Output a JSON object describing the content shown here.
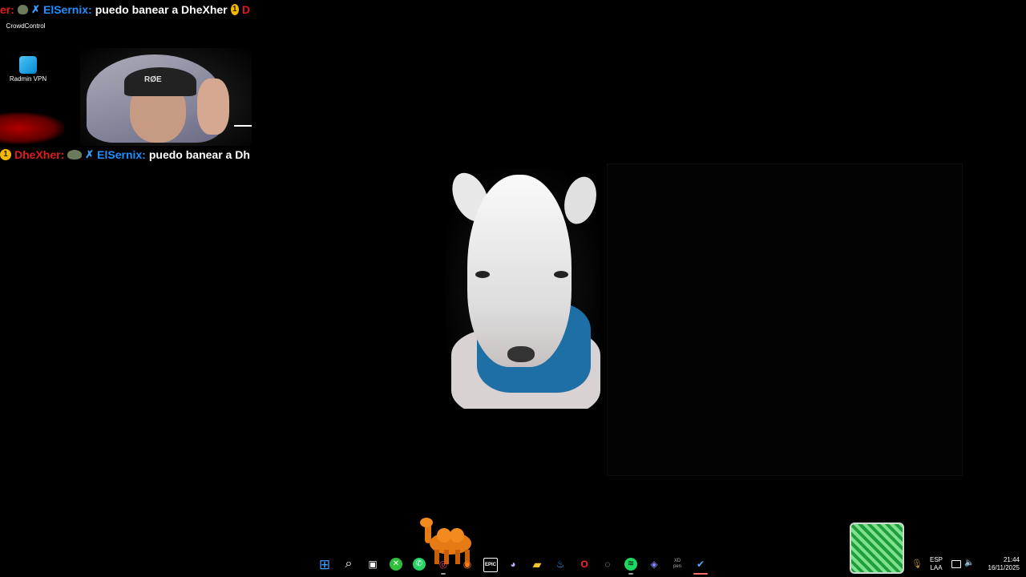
{
  "stream_overlay": {
    "chat_top": {
      "user1_tail": "er:",
      "user2": "ElSernix:",
      "message": "puedo banear a DheXher",
      "badge_count": "1",
      "trailing": "D"
    },
    "chat_bottom": {
      "badge_count": "1",
      "user1": "DheXher:",
      "user2": "ElSernix:",
      "message": "puedo banear a Dh"
    },
    "webcam": {
      "cap_text": "RØE"
    }
  },
  "desktop": {
    "icons": [
      {
        "label": "CrowdControl",
        "icon": "crowdcontrol-icon"
      },
      {
        "label": "Radmin VPN",
        "icon": "radmin-vpn-icon"
      }
    ]
  },
  "taskbar": {
    "apps": [
      {
        "name": "windows-start",
        "glyph": "⊞",
        "color": "#3aa0ff"
      },
      {
        "name": "search",
        "glyph": "⌕",
        "color": "#ffffff"
      },
      {
        "name": "task-view",
        "glyph": "▣",
        "color": "#ffffff"
      },
      {
        "name": "xbox",
        "glyph": "✕",
        "color": "#2fbf3a"
      },
      {
        "name": "whatsapp",
        "glyph": "✆",
        "color": "#25d366"
      },
      {
        "name": "opera-gx",
        "glyph": "◎",
        "color": "#e0336a"
      },
      {
        "name": "firefox",
        "glyph": "◉",
        "color": "#ff7a1a"
      },
      {
        "name": "epic-games",
        "glyph": "EPIC",
        "color": "#ffffff"
      },
      {
        "name": "obs",
        "glyph": "◕",
        "color": "#c9a7ff"
      },
      {
        "name": "file-explorer",
        "glyph": "▰",
        "color": "#f2c230"
      },
      {
        "name": "steam",
        "glyph": "♨",
        "color": "#3aa0ff"
      },
      {
        "name": "opera",
        "glyph": "O",
        "color": "#ff2222"
      },
      {
        "name": "obs-studio",
        "glyph": "◌",
        "color": "#cccccc"
      },
      {
        "name": "spotify",
        "glyph": "≋",
        "color": "#1ed760"
      },
      {
        "name": "proton-vpn",
        "glyph": "◈",
        "color": "#8a8aff"
      },
      {
        "name": "xd-pen",
        "glyph": "XD pen",
        "color": "#aaaaaa"
      },
      {
        "name": "steam-active",
        "glyph": "✔",
        "color": "#5aa9ff"
      }
    ],
    "tray": {
      "mic": "🎙",
      "language": "ESP",
      "layout": "LAA",
      "time": "21:44",
      "date": "16/11/2025"
    }
  },
  "colors": {
    "background": "#000000",
    "chat_red": "#e01b1b",
    "chat_blue": "#1e90ff",
    "badge": "#f5b800"
  }
}
